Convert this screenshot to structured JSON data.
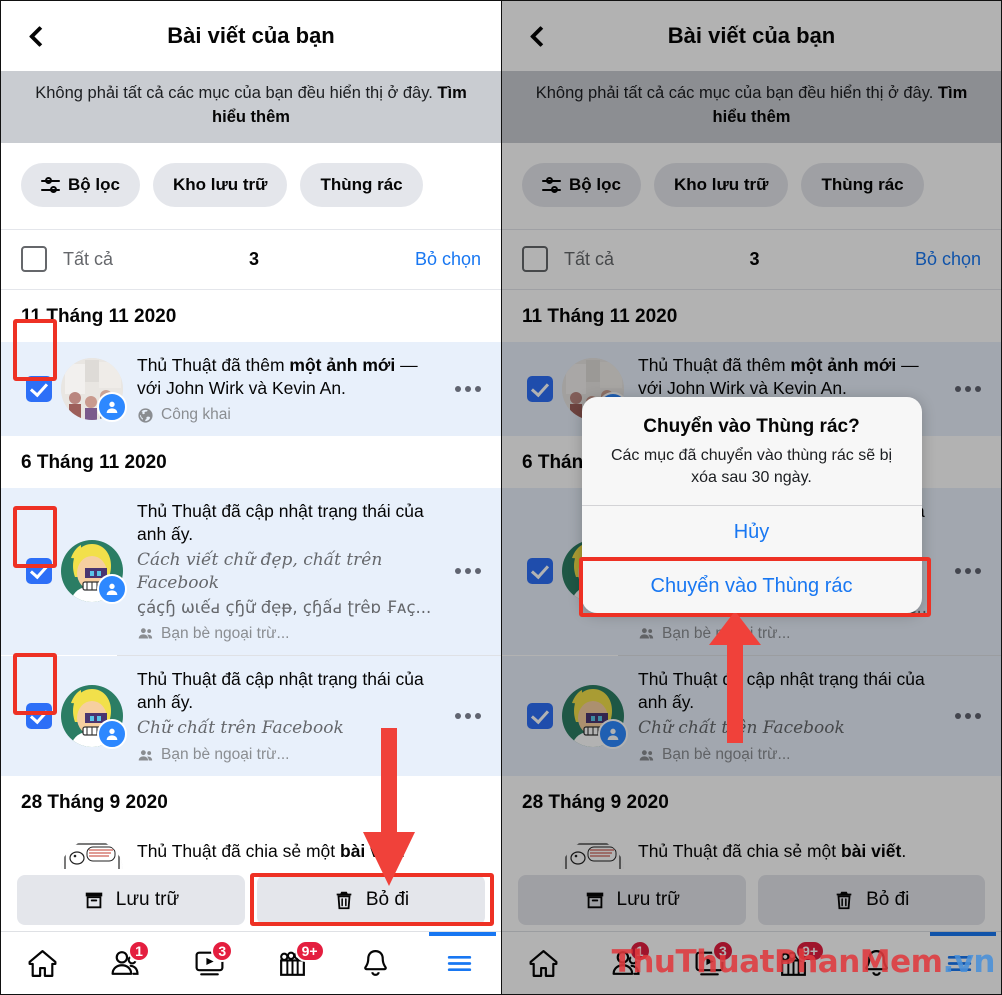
{
  "header": {
    "title": "Bài viết của bạn",
    "back_icon": "back-chevron-icon"
  },
  "banner": {
    "text": "Không phải tất cả các mục của bạn đều hiển thị ở đây. ",
    "link": "Tìm hiểu thêm"
  },
  "chips": [
    {
      "label": "Bộ lọc",
      "icon": "filter-sliders-icon"
    },
    {
      "label": "Kho lưu trữ",
      "icon": ""
    },
    {
      "label": "Thùng rác",
      "icon": ""
    }
  ],
  "select_bar": {
    "all_label": "Tất cả",
    "count": "3",
    "deselect_label": "Bỏ chọn"
  },
  "sections": [
    {
      "date": "11 Tháng 11 2020",
      "posts": [
        {
          "selected": true,
          "title_pre": "Thủ Thuật đã thêm ",
          "title_bold": "một ảnh mới",
          "title_post": " — với John Wirk và Kevin An.",
          "sub_script": "",
          "sub_fancy": "",
          "audience": "Công khai",
          "audience_icon": "globe-icon",
          "avatar": "photo-group"
        }
      ]
    },
    {
      "date": "6 Tháng 11 2020",
      "posts": [
        {
          "selected": true,
          "title_pre": "Thủ Thuật đã cập nhật trạng thái của anh ấy.",
          "title_bold": "",
          "title_post": "",
          "sub_script": "Cách viết chữ đẹp, chất trên Facebook",
          "sub_fancy": "çáçɧ ωιếԁ çɧữ đẹᵽ, çɧấԁ ʈrêɒ ₣ᴀç...",
          "audience": "Bạn bè ngoại trừ...",
          "audience_icon": "friends-icon",
          "avatar": "cartoon-yellow"
        },
        {
          "selected": true,
          "title_pre": "Thủ Thuật đã cập nhật trạng thái của anh ấy.",
          "title_bold": "",
          "title_post": "",
          "sub_script": "Chữ chất trên Facebook",
          "sub_fancy": "",
          "audience": "Bạn bè ngoại trừ...",
          "audience_icon": "friends-icon",
          "avatar": "cartoon-yellow"
        }
      ]
    },
    {
      "date": "28 Tháng 9 2020",
      "posts": [
        {
          "selected": false,
          "title_pre": "Thủ Thuật đã chia sẻ một ",
          "title_bold": "bài viết",
          "title_post": ".",
          "sub_script": "",
          "sub_fancy": "",
          "audience": "",
          "audience_icon": "",
          "avatar": "comic"
        }
      ]
    }
  ],
  "actions": {
    "archive_label": "Lưu trữ",
    "archive_icon": "archive-box-icon",
    "discard_label": "Bỏ đi",
    "discard_icon": "trash-icon"
  },
  "bottom_nav": [
    {
      "name": "home-icon",
      "badge": ""
    },
    {
      "name": "friends-icon",
      "badge": "1"
    },
    {
      "name": "watch-video-icon",
      "badge": "3"
    },
    {
      "name": "marketplace-icon",
      "badge": "9+"
    },
    {
      "name": "notifications-bell-icon",
      "badge": ""
    },
    {
      "name": "menu-hamburger-icon",
      "badge": ""
    }
  ],
  "dialog": {
    "title": "Chuyển vào Thùng rác?",
    "message": "Các mục đã chuyển vào thùng rác sẽ bị xóa sau 30 ngày.",
    "cancel_label": "Hủy",
    "confirm_label": "Chuyển vào Thùng rác"
  },
  "watermark": {
    "part_red": "ThuThuatPhanMem",
    "part_blue": ".vn"
  },
  "colors": {
    "accent_blue": "#1877f2",
    "checkbox_blue": "#2d6ff7",
    "selected_row": "#e8f0fb",
    "annotation_red": "#ee3124",
    "badge_red": "#e41e3f",
    "banner_gray": "#c9ccd1",
    "chip_gray": "#e4e6eb"
  }
}
